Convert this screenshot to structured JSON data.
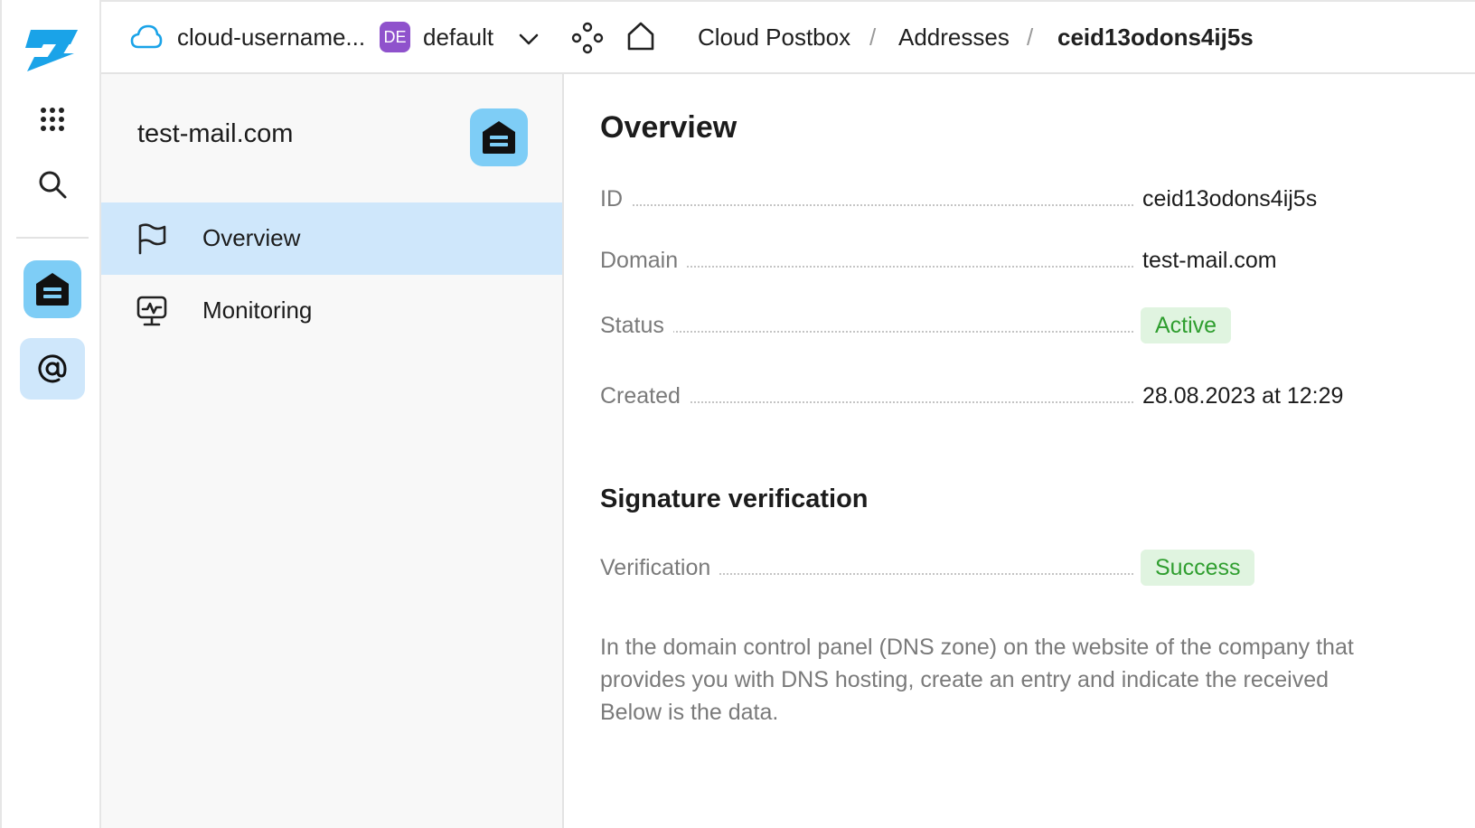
{
  "topbar": {
    "cloud_name": "cloud-username...",
    "folder_badge": "DE",
    "folder_name": "default",
    "breadcrumbs": [
      "Cloud Postbox",
      "Addresses",
      "ceid13odons4ij5s"
    ],
    "separator": "/"
  },
  "sidebar": {
    "title": "test-mail.com",
    "items": [
      {
        "label": "Overview",
        "active": true
      },
      {
        "label": "Monitoring",
        "active": false
      }
    ]
  },
  "overview": {
    "heading": "Overview",
    "fields": [
      {
        "key": "ID",
        "value": "ceid13odons4ij5s"
      },
      {
        "key": "Domain",
        "value": "test-mail.com"
      },
      {
        "key": "Status",
        "value": "Active"
      },
      {
        "key": "Created",
        "value": "28.08.2023 at 12:29"
      }
    ]
  },
  "signature": {
    "heading": "Signature verification",
    "key": "Verification",
    "value": "Success",
    "description": "In the domain control panel (DNS zone) on the website of the company that provides you with DNS hosting, create an entry and indicate the received Below is the data."
  },
  "colors": {
    "accent": "#7ecdf6",
    "active_bg": "#cfe7fb",
    "success_bg": "#e0f4e0",
    "success_text": "#2f9e2f",
    "badge": "#8f52cc"
  },
  "icons": [
    "logo-icon",
    "apps-grid-icon",
    "search-icon",
    "postbox-icon",
    "at-sign-icon",
    "cloud-icon",
    "chevron-down-icon",
    "graph-icon",
    "home-icon",
    "flag-icon",
    "monitoring-icon"
  ]
}
